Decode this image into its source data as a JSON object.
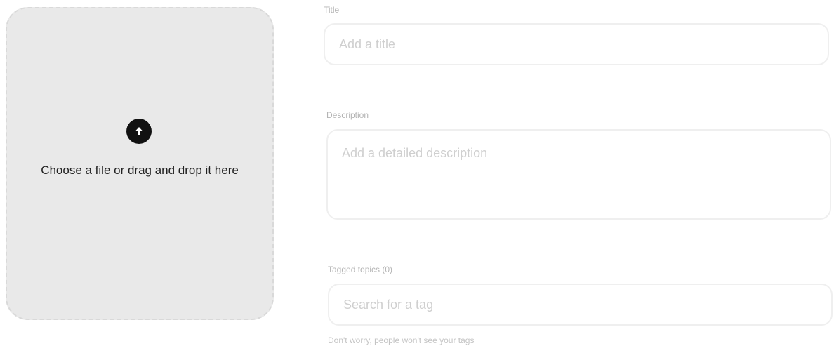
{
  "upload": {
    "icon": "arrow-up-icon",
    "text": "Choose a file or drag and drop it here"
  },
  "title_field": {
    "label": "Title",
    "placeholder": "Add a title"
  },
  "description_field": {
    "label": "Description",
    "placeholder": "Add a detailed description"
  },
  "tags_field": {
    "label": "Tagged topics (0)",
    "placeholder": "Search for a tag",
    "helper": "Don't worry, people won't see your tags"
  },
  "colors": {
    "dropzone_bg": "#e9e9e9",
    "icon_bg": "#111111",
    "label": "#b4b4b4",
    "border": "#efefef"
  }
}
